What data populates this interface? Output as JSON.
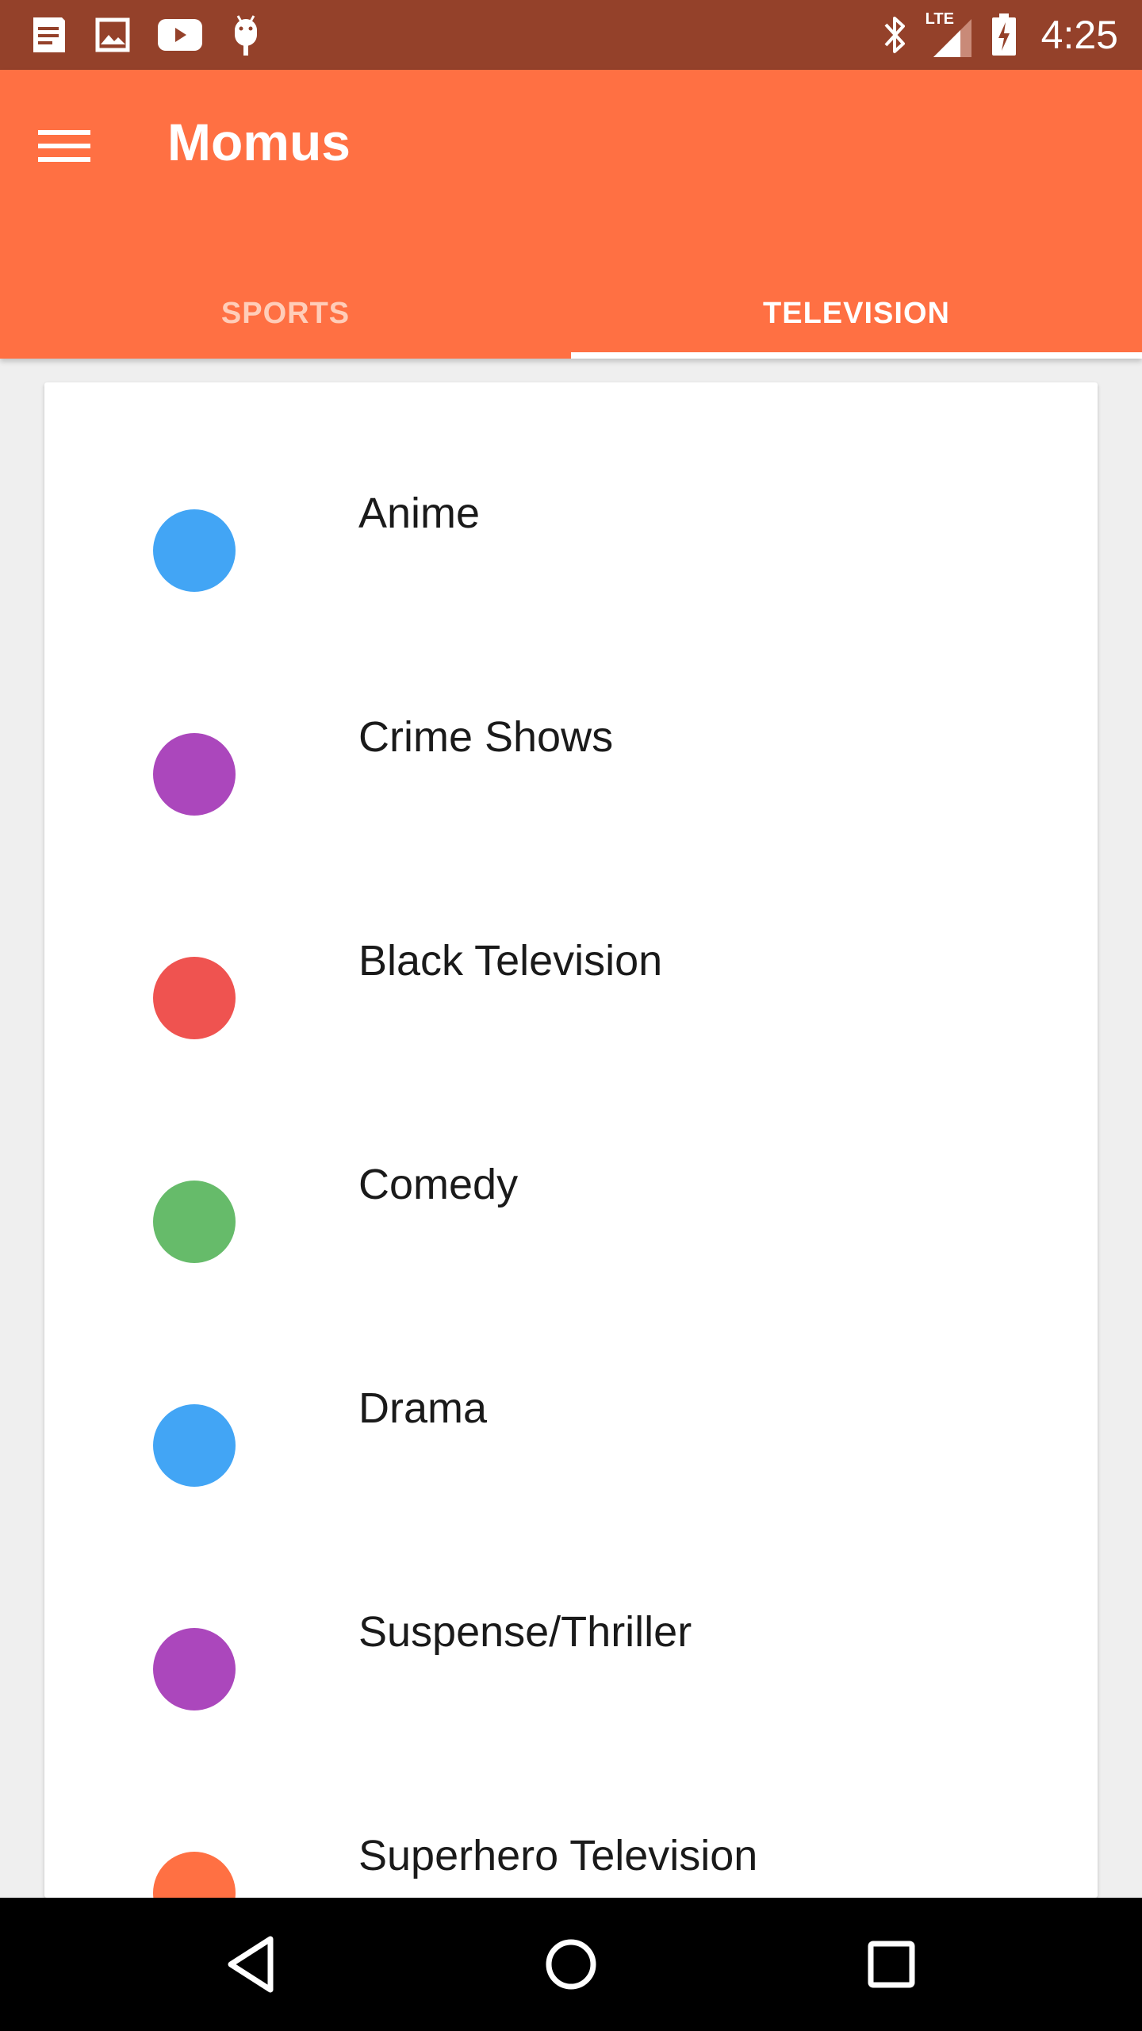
{
  "status_bar": {
    "time": "4:25",
    "network": "LTE",
    "left_icons": [
      "notes-icon",
      "image-icon",
      "youtube-icon",
      "android-debug-icon"
    ],
    "right_icons": [
      "bluetooth-icon",
      "lte-signal-icon",
      "battery-charging-icon"
    ]
  },
  "app_bar": {
    "title": "Momus",
    "menu_icon": "menu-icon",
    "color": "#ff7043"
  },
  "tabs": [
    {
      "label": "SPORTS",
      "selected": false
    },
    {
      "label": "TELEVISION",
      "selected": true
    }
  ],
  "categories": [
    {
      "label": "Anime",
      "color": "#42a5f5"
    },
    {
      "label": "Crime Shows",
      "color": "#ab47bc"
    },
    {
      "label": "Black Television",
      "color": "#ef5350"
    },
    {
      "label": "Comedy",
      "color": "#66bb6a"
    },
    {
      "label": "Drama",
      "color": "#42a5f5"
    },
    {
      "label": "Suspense/Thriller",
      "color": "#ab47bc"
    },
    {
      "label": "Superhero Television",
      "color": "#ff7043"
    }
  ],
  "nav_bar": {
    "buttons": [
      "back-icon",
      "home-icon",
      "recents-icon"
    ]
  }
}
